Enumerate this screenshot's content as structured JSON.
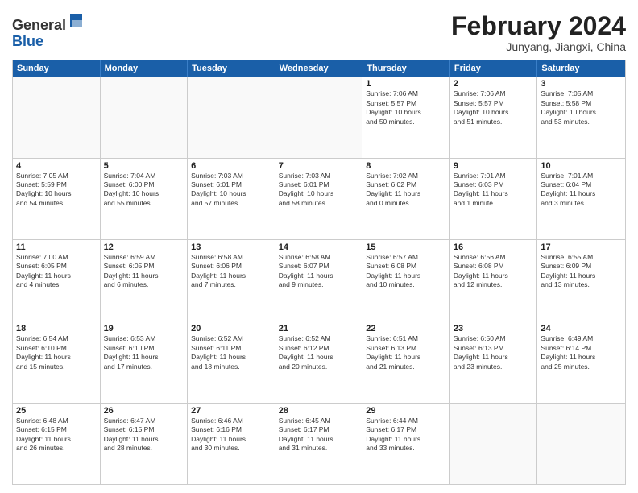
{
  "logo": {
    "general": "General",
    "blue": "Blue"
  },
  "header": {
    "month": "February 2024",
    "location": "Junyang, Jiangxi, China"
  },
  "weekdays": [
    "Sunday",
    "Monday",
    "Tuesday",
    "Wednesday",
    "Thursday",
    "Friday",
    "Saturday"
  ],
  "weeks": [
    [
      {
        "day": "",
        "text": ""
      },
      {
        "day": "",
        "text": ""
      },
      {
        "day": "",
        "text": ""
      },
      {
        "day": "",
        "text": ""
      },
      {
        "day": "1",
        "text": "Sunrise: 7:06 AM\nSunset: 5:57 PM\nDaylight: 10 hours\nand 50 minutes."
      },
      {
        "day": "2",
        "text": "Sunrise: 7:06 AM\nSunset: 5:57 PM\nDaylight: 10 hours\nand 51 minutes."
      },
      {
        "day": "3",
        "text": "Sunrise: 7:05 AM\nSunset: 5:58 PM\nDaylight: 10 hours\nand 53 minutes."
      }
    ],
    [
      {
        "day": "4",
        "text": "Sunrise: 7:05 AM\nSunset: 5:59 PM\nDaylight: 10 hours\nand 54 minutes."
      },
      {
        "day": "5",
        "text": "Sunrise: 7:04 AM\nSunset: 6:00 PM\nDaylight: 10 hours\nand 55 minutes."
      },
      {
        "day": "6",
        "text": "Sunrise: 7:03 AM\nSunset: 6:01 PM\nDaylight: 10 hours\nand 57 minutes."
      },
      {
        "day": "7",
        "text": "Sunrise: 7:03 AM\nSunset: 6:01 PM\nDaylight: 10 hours\nand 58 minutes."
      },
      {
        "day": "8",
        "text": "Sunrise: 7:02 AM\nSunset: 6:02 PM\nDaylight: 11 hours\nand 0 minutes."
      },
      {
        "day": "9",
        "text": "Sunrise: 7:01 AM\nSunset: 6:03 PM\nDaylight: 11 hours\nand 1 minute."
      },
      {
        "day": "10",
        "text": "Sunrise: 7:01 AM\nSunset: 6:04 PM\nDaylight: 11 hours\nand 3 minutes."
      }
    ],
    [
      {
        "day": "11",
        "text": "Sunrise: 7:00 AM\nSunset: 6:05 PM\nDaylight: 11 hours\nand 4 minutes."
      },
      {
        "day": "12",
        "text": "Sunrise: 6:59 AM\nSunset: 6:05 PM\nDaylight: 11 hours\nand 6 minutes."
      },
      {
        "day": "13",
        "text": "Sunrise: 6:58 AM\nSunset: 6:06 PM\nDaylight: 11 hours\nand 7 minutes."
      },
      {
        "day": "14",
        "text": "Sunrise: 6:58 AM\nSunset: 6:07 PM\nDaylight: 11 hours\nand 9 minutes."
      },
      {
        "day": "15",
        "text": "Sunrise: 6:57 AM\nSunset: 6:08 PM\nDaylight: 11 hours\nand 10 minutes."
      },
      {
        "day": "16",
        "text": "Sunrise: 6:56 AM\nSunset: 6:08 PM\nDaylight: 11 hours\nand 12 minutes."
      },
      {
        "day": "17",
        "text": "Sunrise: 6:55 AM\nSunset: 6:09 PM\nDaylight: 11 hours\nand 13 minutes."
      }
    ],
    [
      {
        "day": "18",
        "text": "Sunrise: 6:54 AM\nSunset: 6:10 PM\nDaylight: 11 hours\nand 15 minutes."
      },
      {
        "day": "19",
        "text": "Sunrise: 6:53 AM\nSunset: 6:10 PM\nDaylight: 11 hours\nand 17 minutes."
      },
      {
        "day": "20",
        "text": "Sunrise: 6:52 AM\nSunset: 6:11 PM\nDaylight: 11 hours\nand 18 minutes."
      },
      {
        "day": "21",
        "text": "Sunrise: 6:52 AM\nSunset: 6:12 PM\nDaylight: 11 hours\nand 20 minutes."
      },
      {
        "day": "22",
        "text": "Sunrise: 6:51 AM\nSunset: 6:13 PM\nDaylight: 11 hours\nand 21 minutes."
      },
      {
        "day": "23",
        "text": "Sunrise: 6:50 AM\nSunset: 6:13 PM\nDaylight: 11 hours\nand 23 minutes."
      },
      {
        "day": "24",
        "text": "Sunrise: 6:49 AM\nSunset: 6:14 PM\nDaylight: 11 hours\nand 25 minutes."
      }
    ],
    [
      {
        "day": "25",
        "text": "Sunrise: 6:48 AM\nSunset: 6:15 PM\nDaylight: 11 hours\nand 26 minutes."
      },
      {
        "day": "26",
        "text": "Sunrise: 6:47 AM\nSunset: 6:15 PM\nDaylight: 11 hours\nand 28 minutes."
      },
      {
        "day": "27",
        "text": "Sunrise: 6:46 AM\nSunset: 6:16 PM\nDaylight: 11 hours\nand 30 minutes."
      },
      {
        "day": "28",
        "text": "Sunrise: 6:45 AM\nSunset: 6:17 PM\nDaylight: 11 hours\nand 31 minutes."
      },
      {
        "day": "29",
        "text": "Sunrise: 6:44 AM\nSunset: 6:17 PM\nDaylight: 11 hours\nand 33 minutes."
      },
      {
        "day": "",
        "text": ""
      },
      {
        "day": "",
        "text": ""
      }
    ]
  ]
}
